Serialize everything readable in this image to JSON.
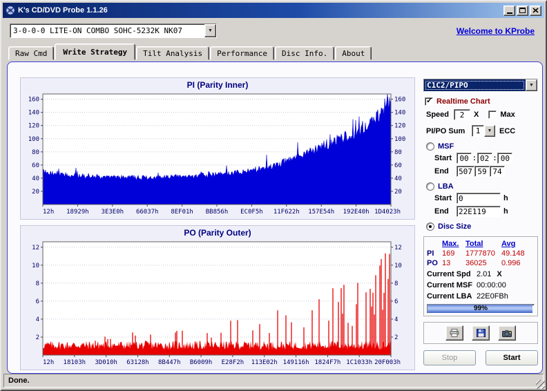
{
  "window": {
    "title": "K's CD/DVD Probe 1.1.26",
    "status_text": "Done."
  },
  "toolbar": {
    "drive_combo_value": "3-0-0-0 LITE-ON COMBO SOHC-5232K NK07",
    "link_text": "Welcome to KProbe"
  },
  "tabs": [
    {
      "label": "Raw Cmd",
      "active": false
    },
    {
      "label": "Write Strategy",
      "active": true
    },
    {
      "label": "Tilt Analysis",
      "active": false
    },
    {
      "label": "Performance",
      "active": false
    },
    {
      "label": "Disc Info.",
      "active": false
    },
    {
      "label": "About",
      "active": false
    }
  ],
  "chart_data": [
    {
      "type": "area",
      "title": "PI (Parity Inner)",
      "color": "#0000d8",
      "ylim": [
        0,
        168
      ],
      "yticks": [
        20,
        40,
        60,
        80,
        100,
        120,
        140,
        160
      ],
      "x_labels": [
        "12h",
        "18929h",
        "3E3E0h",
        "66037h",
        "8EF01h",
        "BB856h",
        "EC0F5h",
        "11F622h",
        "157E54h",
        "192E40h",
        "1D4023h"
      ],
      "envelope_x": [
        0,
        0.04,
        0.1,
        0.2,
        0.3,
        0.4,
        0.5,
        0.6,
        0.65,
        0.7,
        0.75,
        0.8,
        0.85,
        0.9,
        0.95,
        1
      ],
      "envelope_y": [
        50,
        47,
        44,
        42,
        41,
        43,
        46,
        52,
        58,
        66,
        76,
        88,
        100,
        112,
        128,
        158
      ],
      "grid": true,
      "legend": false,
      "stats": {
        "max": 169,
        "total": 1777870,
        "avg": 49.148
      }
    },
    {
      "type": "bar",
      "title": "PO (Parity Outer)",
      "color": "#e80000",
      "ylim": [
        0,
        12.6
      ],
      "yticks": [
        2,
        4,
        6,
        8,
        10,
        12
      ],
      "x_labels": [
        "12h",
        "18103h",
        "3D010h",
        "63128h",
        "8B447h",
        "B6009h",
        "E28F2h",
        "113E02h",
        "149116h",
        "1824F7h",
        "1C1033h",
        "20F003h"
      ],
      "baseline": [
        0.6,
        1.6
      ],
      "spike_envelope_x": [
        0,
        0.2,
        0.4,
        0.6,
        0.7,
        0.8,
        0.9,
        0.95,
        1
      ],
      "spike_envelope_y": [
        2,
        2.5,
        3,
        4.5,
        5.5,
        7,
        9,
        11,
        12
      ],
      "grid": true,
      "legend": false,
      "stats": {
        "max": 13,
        "total": 36025,
        "avg": 0.996
      }
    }
  ],
  "panel": {
    "mode_combo": "C1C2/PIPO",
    "realtime": {
      "label": "Realtime Chart",
      "checked": true
    },
    "speed": {
      "label": "Speed",
      "value": "2",
      "unit": "X",
      "max_label": "Max",
      "max_checked": false
    },
    "pipo_sum": {
      "label": "PI/PO Sum",
      "value": "1",
      "unit": "ECC"
    },
    "msf": {
      "label": "MSF",
      "selected": false,
      "start_label": "Start",
      "end_label": "End",
      "sep": ":",
      "start": [
        "00",
        "02",
        "00"
      ],
      "end": [
        "507",
        "59",
        "74"
      ]
    },
    "lba": {
      "label": "LBA",
      "selected": false,
      "start_label": "Start",
      "end_label": "End",
      "start": "0",
      "end": "22E119",
      "unit": "h"
    },
    "disc_size": {
      "label": "Disc Size",
      "selected": true
    },
    "stats": {
      "headers": [
        "Max.",
        "Total",
        "Avg"
      ],
      "rows": [
        {
          "name": "PI",
          "max": "169",
          "total": "1777870",
          "avg": "49.148"
        },
        {
          "name": "PO",
          "max": "13",
          "total": "36025",
          "avg": "0.996"
        }
      ]
    },
    "current_spd": {
      "label": "Current Spd",
      "value": "2.01",
      "unit": "X"
    },
    "current_msf": {
      "label": "Current MSF",
      "value": "00:00:00"
    },
    "current_lba": {
      "label": "Current LBA",
      "value": "22E0FBh"
    },
    "progress": {
      "percent": 99,
      "text": "99%"
    },
    "actions": {
      "stop": "Stop",
      "start": "Start"
    }
  }
}
